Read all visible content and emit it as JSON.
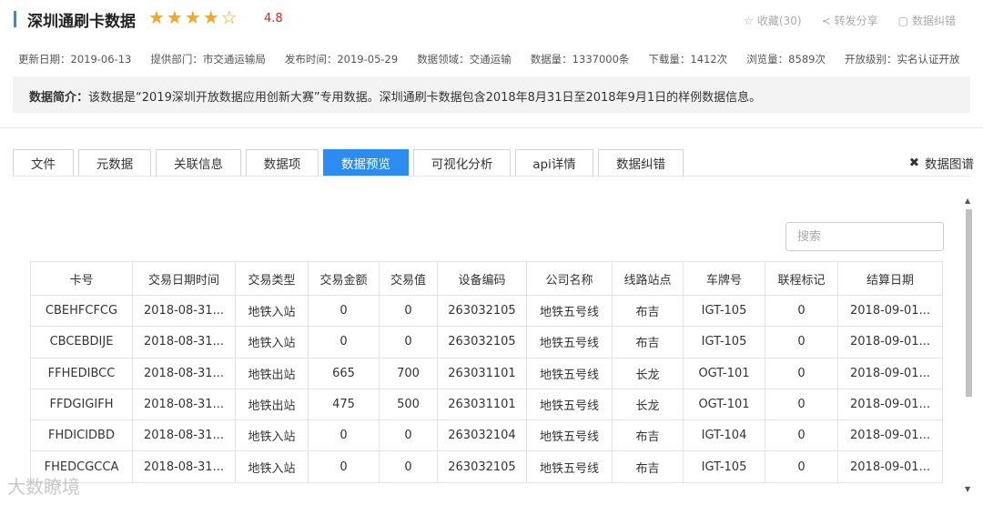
{
  "header": {
    "title": "深圳通刷卡数据",
    "stars": "★★★★☆",
    "rating": "4.8",
    "actions": [
      {
        "icon": "star-outline-icon",
        "glyph": "☆",
        "label": "收藏(30)"
      },
      {
        "icon": "share-icon",
        "glyph": "≺",
        "label": "转发分享"
      },
      {
        "icon": "correction-icon",
        "glyph": "▢",
        "label": "数据纠错"
      }
    ]
  },
  "meta": [
    "更新日期：2019-06-13",
    "提供部门：市交通运输局",
    "发布时间：2019-05-29",
    "数据领域：交通运输",
    "数据量：1337000条",
    "下载量：1412次",
    "浏览量：8589次",
    "开放级别：实名认证开放"
  ],
  "summary": {
    "label": "数据简介：",
    "text": "该数据是“2019深圳开放数据应用创新大赛”专用数据。深圳通刷卡数据包含2018年8月31日至2018年9月1日的样例数据信息。"
  },
  "tabs": [
    {
      "label": "文件",
      "active": false
    },
    {
      "label": "元数据",
      "active": false
    },
    {
      "label": "关联信息",
      "active": false
    },
    {
      "label": "数据项",
      "active": false
    },
    {
      "label": "数据预览",
      "active": true
    },
    {
      "label": "可视化分析",
      "active": false
    },
    {
      "label": "api详情",
      "active": false
    },
    {
      "label": "数据纠错",
      "active": false
    }
  ],
  "graph_link": {
    "icon": "graph-icon",
    "glyph": "✖",
    "label": "数据图谱"
  },
  "search": {
    "placeholder": "搜索"
  },
  "table": {
    "headers": [
      "卡号",
      "交易日期时间",
      "交易类型",
      "交易金额",
      "交易值",
      "设备编码",
      "公司名称",
      "线路站点",
      "车牌号",
      "联程标记",
      "结算日期"
    ],
    "rows": [
      [
        "CBEHFCFCG",
        "2018-08-31...",
        "地铁入站",
        "0",
        "0",
        "263032105",
        "地铁五号线",
        "布吉",
        "IGT-105",
        "0",
        "2018-09-01..."
      ],
      [
        "CBCEBDIJE",
        "2018-08-31...",
        "地铁入站",
        "0",
        "0",
        "263032105",
        "地铁五号线",
        "布吉",
        "IGT-105",
        "0",
        "2018-09-01..."
      ],
      [
        "FFHEDIBCC",
        "2018-08-31...",
        "地铁出站",
        "665",
        "700",
        "263031101",
        "地铁五号线",
        "长龙",
        "OGT-101",
        "0",
        "2018-09-01..."
      ],
      [
        "FFDGIGIFH",
        "2018-08-31...",
        "地铁出站",
        "475",
        "500",
        "263031101",
        "地铁五号线",
        "长龙",
        "OGT-101",
        "0",
        "2018-09-01..."
      ],
      [
        "FHDICIDBD",
        "2018-08-31...",
        "地铁入站",
        "0",
        "0",
        "263032104",
        "地铁五号线",
        "布吉",
        "IGT-104",
        "0",
        "2018-09-01..."
      ],
      [
        "FHEDCGCCA",
        "2018-08-31...",
        "地铁入站",
        "0",
        "0",
        "263032105",
        "地铁五号线",
        "布吉",
        "IGT-105",
        "0",
        "2018-09-01..."
      ]
    ]
  },
  "watermark": "大数瞭境",
  "colors": {
    "accent": "#2d8cf0",
    "star": "#f5a623",
    "rating": "#e2231a"
  }
}
